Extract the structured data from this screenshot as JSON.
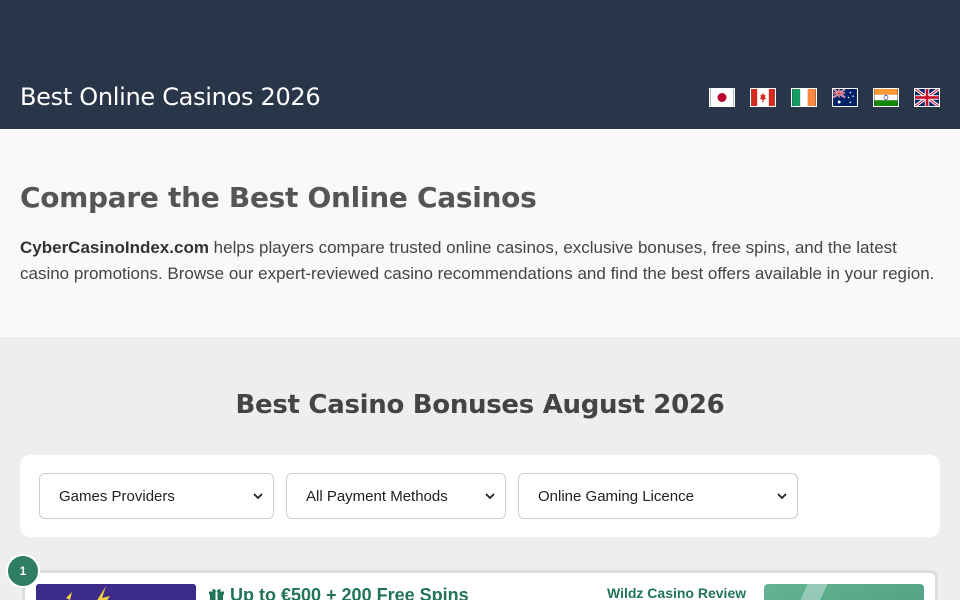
{
  "header": {
    "site_title": "Best Online Casinos 2026",
    "flags": [
      {
        "icon": "japan-flag-icon"
      },
      {
        "icon": "canada-flag-icon"
      },
      {
        "icon": "ireland-flag-icon"
      },
      {
        "icon": "australia-flag-icon"
      },
      {
        "icon": "india-flag-icon"
      },
      {
        "icon": "uk-flag-icon"
      }
    ],
    "background": "#293649"
  },
  "intro": {
    "heading": "Compare the Best Online Casinos",
    "brand": "CyberCasinoIndex.com",
    "text": " helps players compare trusted online casinos, exclusive bonuses, free spins, and the latest casino promotions. Browse our expert-reviewed casino recommendations and find the best offers available in your region."
  },
  "bonuses": {
    "heading": "Best Casino Bonuses August 2026",
    "filters": [
      {
        "selected": "Games Providers"
      },
      {
        "selected": "All Payment Methods"
      },
      {
        "selected": "Online Gaming Licence"
      }
    ],
    "casinos": [
      {
        "rank": "1",
        "bonus": "Up to €500 + 200 Free Spins",
        "review_label": "Wildz Casino Review"
      }
    ]
  },
  "colors": {
    "accent_green": "#21735a",
    "badge_green": "#2e7d64",
    "logo_purple": "#3d2b8c"
  }
}
